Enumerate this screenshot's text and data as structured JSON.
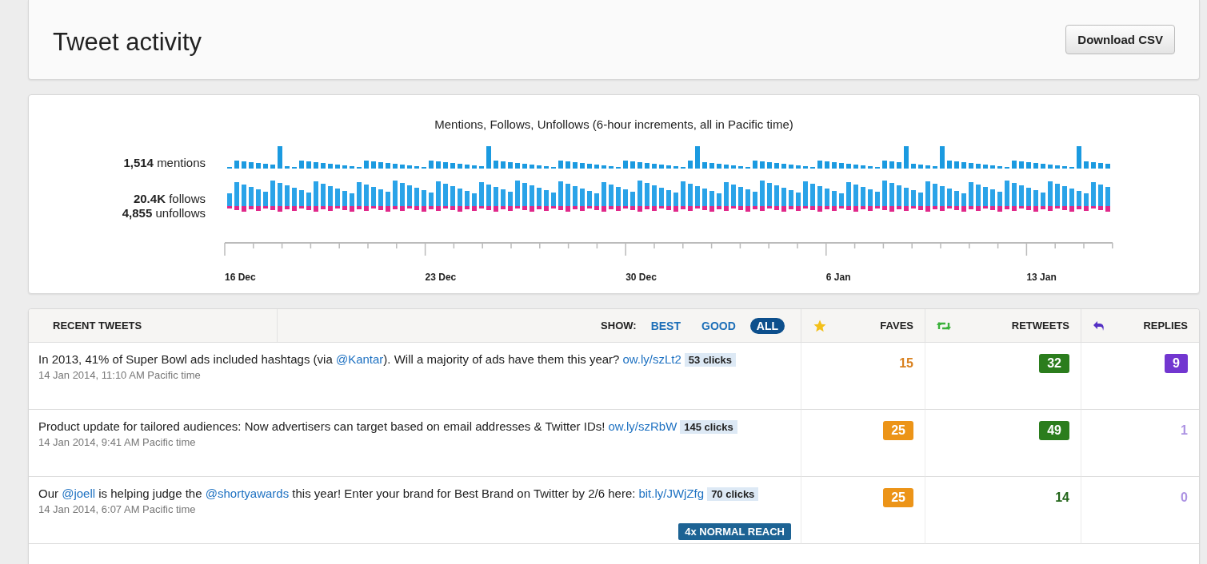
{
  "header": {
    "title": "Tweet activity",
    "download_button": "Download CSV"
  },
  "activity": {
    "title": "Mentions, Follows, Unfollows (6-hour increments, all in Pacific time)",
    "series": [
      {
        "kind": "mentions",
        "total": "1,514",
        "label": "mentions"
      },
      {
        "kind": "follows",
        "total": "20.4K",
        "label": "follows"
      },
      {
        "kind": "unfollows",
        "total": "4,855",
        "label": "unfollows"
      }
    ],
    "x_labels": [
      "16 Dec",
      "23 Dec",
      "30 Dec",
      "6 Jan",
      "13 Jan"
    ]
  },
  "recent_tweets": {
    "title": "RECENT TWEETS",
    "show_label": "SHOW:",
    "filters": [
      {
        "label": "BEST",
        "selected": false
      },
      {
        "label": "GOOD",
        "selected": false
      },
      {
        "label": "ALL",
        "selected": true
      }
    ],
    "columns": [
      {
        "kind": "faves",
        "label": "FAVES"
      },
      {
        "kind": "retweets",
        "label": "RETWEETS"
      },
      {
        "kind": "replies",
        "label": "REPLIES"
      }
    ],
    "rows": [
      {
        "text": [
          {
            "kind": "text",
            "text": "In 2013, 41% of Super Bowl ads included hashtags (via "
          },
          {
            "kind": "mention",
            "text": "@Kantar"
          },
          {
            "kind": "text",
            "text": "). Will a majority of ads have them this year?"
          }
        ],
        "link": "ow.ly/szLt2",
        "clicks": "53 clicks",
        "time": "14 Jan 2014, 11:10 AM Pacific time",
        "faves": {
          "value": "15",
          "highlighted": false
        },
        "retweets": {
          "value": "32",
          "highlighted": true
        },
        "replies": {
          "value": "9",
          "highlighted": true
        }
      },
      {
        "text": [
          {
            "kind": "text",
            "text": "Product update for tailored audiences: Now advertisers can target based on email addresses & Twitter IDs!"
          }
        ],
        "link": "ow.ly/szRbW",
        "clicks": "145 clicks",
        "time": "14 Jan 2014, 9:41 AM Pacific time",
        "faves": {
          "value": "25",
          "highlighted": true
        },
        "retweets": {
          "value": "49",
          "highlighted": true
        },
        "replies": {
          "value": "1",
          "highlighted": false
        }
      },
      {
        "text": [
          {
            "kind": "text",
            "text": "Our "
          },
          {
            "kind": "mention",
            "text": "@joell"
          },
          {
            "kind": "text",
            "text": " is helping judge the "
          },
          {
            "kind": "mention",
            "text": "@shortyawards"
          },
          {
            "kind": "text",
            "text": " this year! Enter your brand for Best Brand on Twitter by 2/6 here:"
          }
        ],
        "link": "bit.ly/JWjZfg",
        "clicks": "70 clicks",
        "time": "14 Jan 2014, 6:07 AM Pacific time",
        "reach": "4x NORMAL REACH",
        "faves": {
          "value": "25",
          "highlighted": true
        },
        "retweets": {
          "value": "14",
          "highlighted": false
        },
        "replies": {
          "value": "0",
          "highlighted": false
        }
      }
    ]
  }
}
